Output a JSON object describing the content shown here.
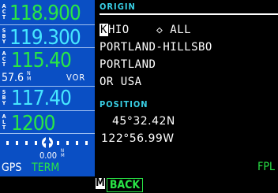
{
  "left_panel": {
    "com_active": {
      "tag": "ACT",
      "value": "118.900"
    },
    "com_standby": {
      "tag": "SBY",
      "value": "119.300"
    },
    "nav_active": {
      "tag": "ACT",
      "value": "115.40"
    },
    "nav_dist": {
      "value": "57.6",
      "unit": "NM",
      "mode": "VOR"
    },
    "nav_standby": {
      "tag": "SBY",
      "value": "117.40"
    },
    "altitude": {
      "tag": "ALT",
      "value": "1200"
    },
    "cdi": {
      "deviation": "0.00",
      "unit": "NM"
    },
    "gps_label": "GPS",
    "mode_label": "TERM"
  },
  "right_panel": {
    "origin_label": "ORIGIN",
    "ident_first_char": "K",
    "ident_rest": "HIO",
    "filter_symbol": "◇",
    "filter_label": "ALL",
    "name_line": "PORTLAND-HILLSBO",
    "city": "PORTLAND",
    "region": "OR USA",
    "position_label": "POSITION",
    "lat": "45°32.42N",
    "lon": "122°56.99W",
    "page_label": "FPL"
  },
  "bottom_bar": {
    "m_key": "M",
    "back_label": "BACK"
  },
  "colors": {
    "panel_blue": "#0a4fc4",
    "active_green": "#29e646",
    "standby_cyan": "#46e6ff",
    "label_cyan": "#39d0e6"
  }
}
